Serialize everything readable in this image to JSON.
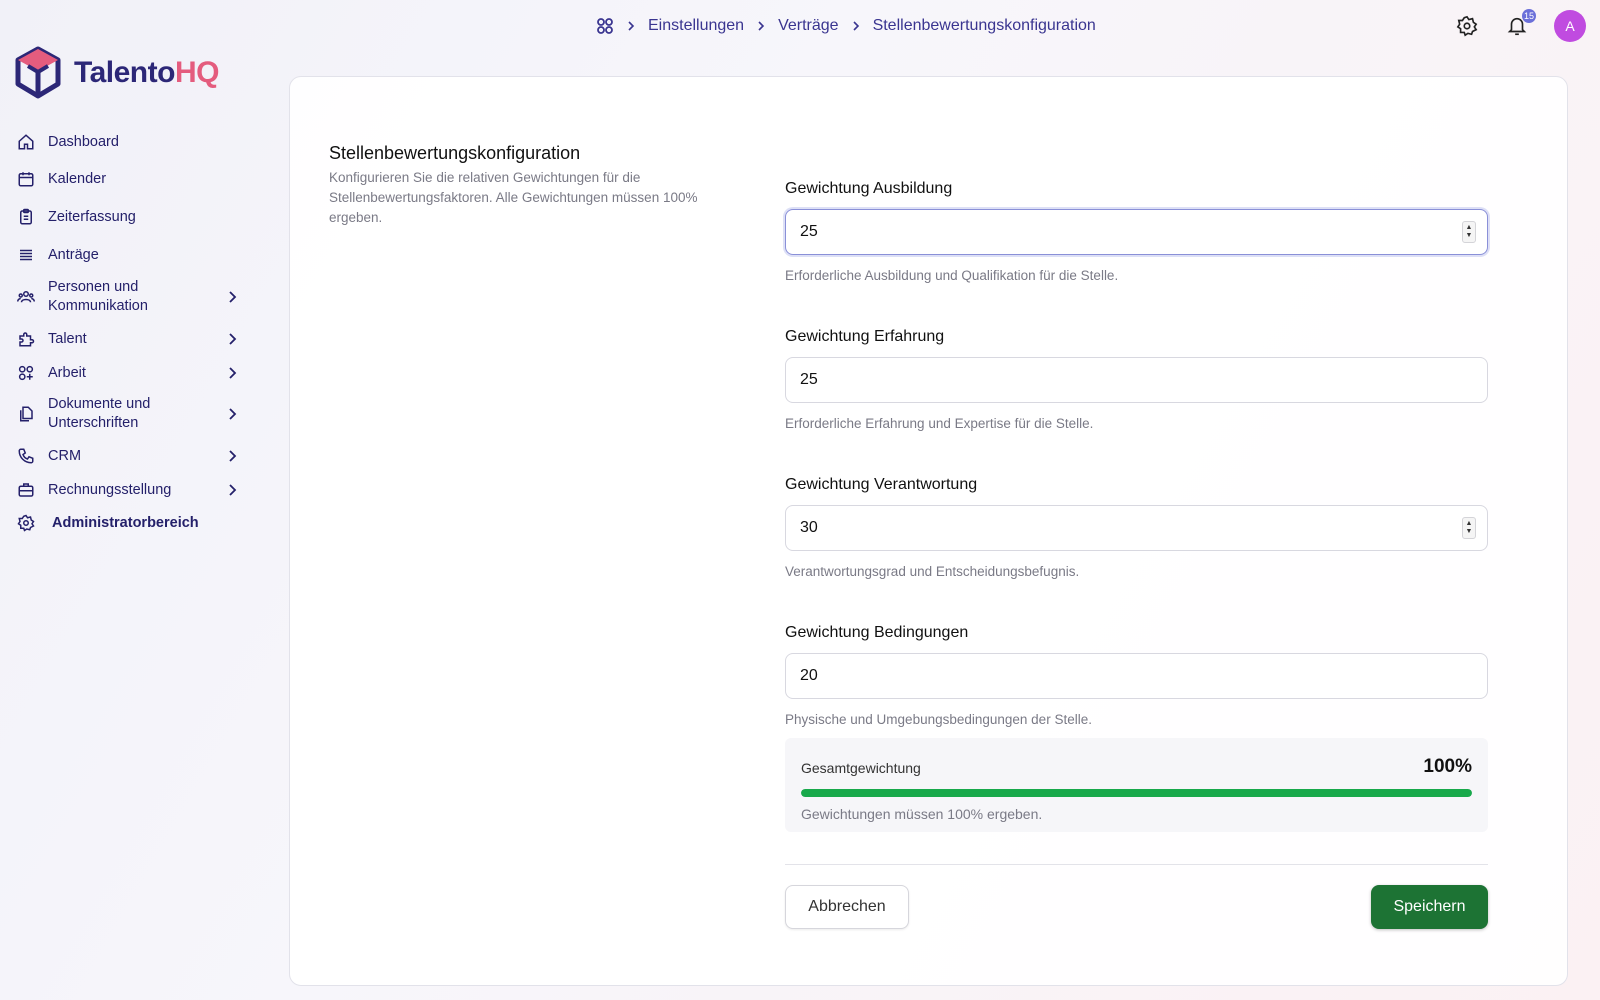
{
  "brand": {
    "name_part1": "Talento",
    "name_part2": "HQ",
    "colors": {
      "dark": "#2c2777",
      "accent": "#e45c7e"
    }
  },
  "breadcrumb": {
    "icon": "apps-grid-icon",
    "items": [
      "Einstellungen",
      "Verträge",
      "Stellenbewertungskonfiguration"
    ]
  },
  "topbar": {
    "notification_count": "15",
    "avatar_initial": "A"
  },
  "sidebar": {
    "items": [
      {
        "label": "Dashboard",
        "icon": "home-icon"
      },
      {
        "label": "Kalender",
        "icon": "calendar-icon"
      },
      {
        "label": "Zeiterfassung",
        "icon": "clipboard-icon"
      },
      {
        "label": "Anträge",
        "icon": "stack-icon"
      },
      {
        "label": "Personen und Kommunikation",
        "icon": "people-icon",
        "expandable": true
      },
      {
        "label": "Talent",
        "icon": "puzzle-icon",
        "expandable": true
      },
      {
        "label": "Arbeit",
        "icon": "widgets-icon",
        "expandable": true
      },
      {
        "label": "Dokumente und Unterschriften",
        "icon": "documents-icon",
        "expandable": true
      },
      {
        "label": "CRM",
        "icon": "phone-icon",
        "expandable": true
      },
      {
        "label": "Rechnungsstellung",
        "icon": "briefcase-icon",
        "expandable": true
      },
      {
        "label": "Administratorbereich",
        "icon": "gear-icon"
      }
    ]
  },
  "section": {
    "title": "Stellenbewertungskonfiguration",
    "description": "Konfigurieren Sie die relativen Gewichtungen für die Stellenbewertungsfaktoren. Alle Gewichtungen müssen 100% ergeben."
  },
  "fields": [
    {
      "label": "Gewichtung Ausbildung",
      "value": "25",
      "hint": "Erforderliche Ausbildung und Qualifikation für die Stelle."
    },
    {
      "label": "Gewichtung Erfahrung",
      "value": "25",
      "hint": "Erforderliche Erfahrung und Expertise für die Stelle."
    },
    {
      "label": "Gewichtung Verantwortung",
      "value": "30",
      "hint": "Verantwortungsgrad und Entscheidungsbefugnis."
    },
    {
      "label": "Gewichtung Bedingungen",
      "value": "20",
      "hint": "Physische und Umgebungsbedingungen der Stelle."
    }
  ],
  "total": {
    "label": "Gesamtgewichtung",
    "value": "100%",
    "progress_percent": 100,
    "hint": "Gewichtungen müssen 100% ergeben.",
    "color": "#18a94b"
  },
  "actions": {
    "cancel_label": "Abbrechen",
    "save_label": "Speichern",
    "save_color": "#1d7334"
  }
}
